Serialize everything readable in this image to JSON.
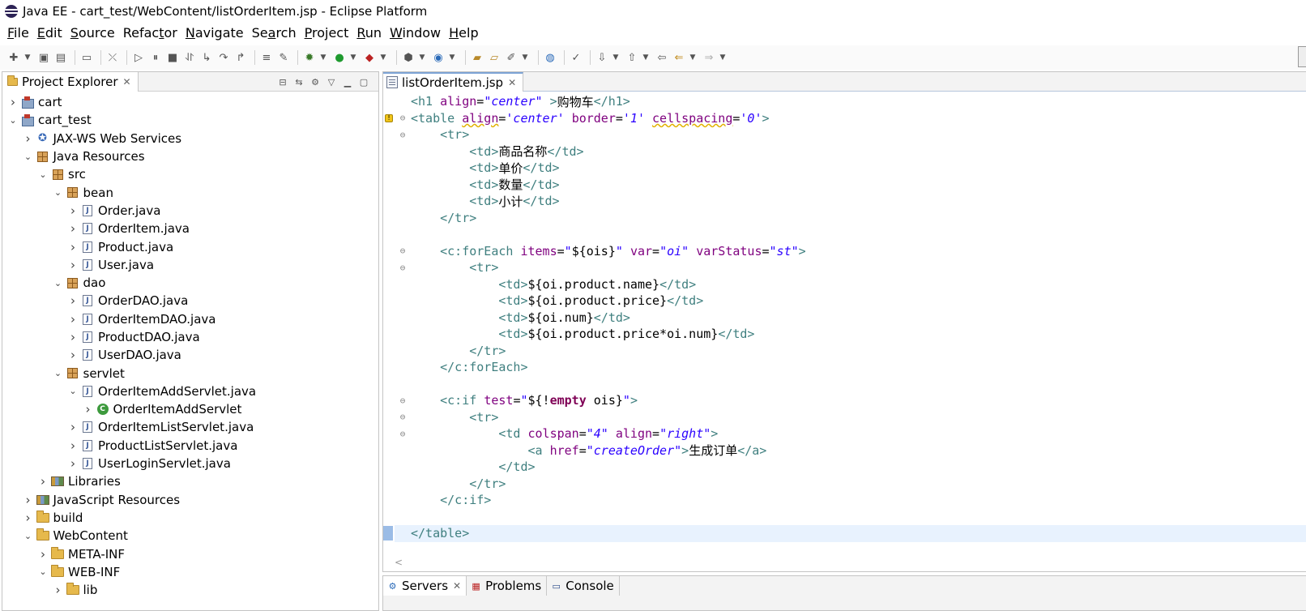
{
  "window": {
    "title": "Java EE - cart_test/WebContent/listOrderItem.jsp - Eclipse Platform"
  },
  "menu": [
    {
      "pre": "",
      "u": "F",
      "post": "ile"
    },
    {
      "pre": "",
      "u": "E",
      "post": "dit"
    },
    {
      "pre": "",
      "u": "S",
      "post": "ource"
    },
    {
      "pre": "Refac",
      "u": "t",
      "post": "or"
    },
    {
      "pre": "",
      "u": "N",
      "post": "avigate"
    },
    {
      "pre": "Se",
      "u": "a",
      "post": "rch"
    },
    {
      "pre": "",
      "u": "P",
      "post": "roject"
    },
    {
      "pre": "",
      "u": "R",
      "post": "un"
    },
    {
      "pre": "",
      "u": "W",
      "post": "indow"
    },
    {
      "pre": "",
      "u": "H",
      "post": "elp"
    }
  ],
  "project_explorer": {
    "title": "Project Explorer",
    "items": [
      {
        "label": "cart",
        "depth": 0,
        "twisty": "closed",
        "icon": "project"
      },
      {
        "label": "cart_test",
        "depth": 0,
        "twisty": "open",
        "icon": "project"
      },
      {
        "label": "JAX-WS Web Services",
        "depth": 1,
        "twisty": "closed",
        "icon": "webservice"
      },
      {
        "label": "Java Resources",
        "depth": 1,
        "twisty": "open",
        "icon": "package"
      },
      {
        "label": "src",
        "depth": 2,
        "twisty": "open",
        "icon": "package"
      },
      {
        "label": "bean",
        "depth": 3,
        "twisty": "open",
        "icon": "package"
      },
      {
        "label": "Order.java",
        "depth": 4,
        "twisty": "closed",
        "icon": "java"
      },
      {
        "label": "OrderItem.java",
        "depth": 4,
        "twisty": "closed",
        "icon": "java"
      },
      {
        "label": "Product.java",
        "depth": 4,
        "twisty": "closed",
        "icon": "java"
      },
      {
        "label": "User.java",
        "depth": 4,
        "twisty": "closed",
        "icon": "java"
      },
      {
        "label": "dao",
        "depth": 3,
        "twisty": "open",
        "icon": "package"
      },
      {
        "label": "OrderDAO.java",
        "depth": 4,
        "twisty": "closed",
        "icon": "java"
      },
      {
        "label": "OrderItemDAO.java",
        "depth": 4,
        "twisty": "closed",
        "icon": "java"
      },
      {
        "label": "ProductDAO.java",
        "depth": 4,
        "twisty": "closed",
        "icon": "java"
      },
      {
        "label": "UserDAO.java",
        "depth": 4,
        "twisty": "closed",
        "icon": "java"
      },
      {
        "label": "servlet",
        "depth": 3,
        "twisty": "open",
        "icon": "package"
      },
      {
        "label": "OrderItemAddServlet.java",
        "depth": 4,
        "twisty": "open",
        "icon": "java"
      },
      {
        "label": "OrderItemAddServlet",
        "depth": 5,
        "twisty": "closed",
        "icon": "class"
      },
      {
        "label": "OrderItemListServlet.java",
        "depth": 4,
        "twisty": "closed",
        "icon": "java"
      },
      {
        "label": "ProductListServlet.java",
        "depth": 4,
        "twisty": "closed",
        "icon": "java"
      },
      {
        "label": "UserLoginServlet.java",
        "depth": 4,
        "twisty": "closed",
        "icon": "java"
      },
      {
        "label": "Libraries",
        "depth": 2,
        "twisty": "closed",
        "icon": "library"
      },
      {
        "label": "JavaScript Resources",
        "depth": 1,
        "twisty": "closed",
        "icon": "library"
      },
      {
        "label": "build",
        "depth": 1,
        "twisty": "closed",
        "icon": "folder"
      },
      {
        "label": "WebContent",
        "depth": 1,
        "twisty": "open",
        "icon": "folder"
      },
      {
        "label": "META-INF",
        "depth": 2,
        "twisty": "closed",
        "icon": "folder"
      },
      {
        "label": "WEB-INF",
        "depth": 2,
        "twisty": "open",
        "icon": "folder"
      },
      {
        "label": "lib",
        "depth": 3,
        "twisty": "closed",
        "icon": "folder"
      }
    ]
  },
  "editor": {
    "tab_label": "listOrderItem.jsp",
    "lines": [
      {
        "fold": "",
        "tokens": [
          [
            "t",
            "<h1 "
          ],
          [
            "a",
            "align"
          ],
          [
            "x",
            "="
          ],
          [
            "v",
            "\"center\""
          ],
          [
            "x",
            " "
          ],
          [
            "t",
            ">"
          ],
          [
            "x",
            "购物车"
          ],
          [
            "t",
            "</h1>"
          ]
        ]
      },
      {
        "fold": "⊖",
        "warn": true,
        "tokens": [
          [
            "t",
            "<table "
          ],
          [
            "a sq",
            "align"
          ],
          [
            "x",
            "="
          ],
          [
            "v",
            "'center'"
          ],
          [
            "x",
            " "
          ],
          [
            "a",
            "border"
          ],
          [
            "x",
            "="
          ],
          [
            "v",
            "'1'"
          ],
          [
            "x",
            " "
          ],
          [
            "a sq",
            "cellspacing"
          ],
          [
            "x",
            "="
          ],
          [
            "v",
            "'0'"
          ],
          [
            "t",
            ">"
          ]
        ]
      },
      {
        "fold": "⊖",
        "tokens": [
          [
            "x",
            "    "
          ],
          [
            "t",
            "<tr>"
          ]
        ]
      },
      {
        "fold": "",
        "tokens": [
          [
            "x",
            "        "
          ],
          [
            "t",
            "<td>"
          ],
          [
            "x",
            "商品名称"
          ],
          [
            "t",
            "</td>"
          ]
        ]
      },
      {
        "fold": "",
        "tokens": [
          [
            "x",
            "        "
          ],
          [
            "t",
            "<td>"
          ],
          [
            "x",
            "单价"
          ],
          [
            "t",
            "</td>"
          ]
        ]
      },
      {
        "fold": "",
        "tokens": [
          [
            "x",
            "        "
          ],
          [
            "t",
            "<td>"
          ],
          [
            "x",
            "数量"
          ],
          [
            "t",
            "</td>"
          ]
        ]
      },
      {
        "fold": "",
        "tokens": [
          [
            "x",
            "        "
          ],
          [
            "t",
            "<td>"
          ],
          [
            "x",
            "小计"
          ],
          [
            "t",
            "</td>"
          ]
        ]
      },
      {
        "fold": "",
        "tokens": [
          [
            "x",
            "    "
          ],
          [
            "t",
            "</tr>"
          ]
        ]
      },
      {
        "fold": "",
        "tokens": []
      },
      {
        "fold": "⊖",
        "tokens": [
          [
            "x",
            "    "
          ],
          [
            "t",
            "<c:forEach "
          ],
          [
            "a",
            "items"
          ],
          [
            "x",
            "="
          ],
          [
            "v",
            "\""
          ],
          [
            "x",
            "${ois}"
          ],
          [
            "v",
            "\""
          ],
          [
            "x",
            " "
          ],
          [
            "a",
            "var"
          ],
          [
            "x",
            "="
          ],
          [
            "v",
            "\"oi\""
          ],
          [
            "x",
            " "
          ],
          [
            "a",
            "varStatus"
          ],
          [
            "x",
            "="
          ],
          [
            "v",
            "\"st\""
          ],
          [
            "t",
            ">"
          ]
        ]
      },
      {
        "fold": "⊖",
        "tokens": [
          [
            "x",
            "        "
          ],
          [
            "t",
            "<tr>"
          ]
        ]
      },
      {
        "fold": "",
        "tokens": [
          [
            "x",
            "            "
          ],
          [
            "t",
            "<td>"
          ],
          [
            "x",
            "${oi.product.name}"
          ],
          [
            "t",
            "</td>"
          ]
        ]
      },
      {
        "fold": "",
        "tokens": [
          [
            "x",
            "            "
          ],
          [
            "t",
            "<td>"
          ],
          [
            "x",
            "${oi.product.price}"
          ],
          [
            "t",
            "</td>"
          ]
        ]
      },
      {
        "fold": "",
        "tokens": [
          [
            "x",
            "            "
          ],
          [
            "t",
            "<td>"
          ],
          [
            "x",
            "${oi.num}"
          ],
          [
            "t",
            "</td>"
          ]
        ]
      },
      {
        "fold": "",
        "tokens": [
          [
            "x",
            "            "
          ],
          [
            "t",
            "<td>"
          ],
          [
            "x",
            "${oi.product.price*oi.num}"
          ],
          [
            "t",
            "</td>"
          ]
        ]
      },
      {
        "fold": "",
        "tokens": [
          [
            "x",
            "        "
          ],
          [
            "t",
            "</tr>"
          ]
        ]
      },
      {
        "fold": "",
        "tokens": [
          [
            "x",
            "    "
          ],
          [
            "t",
            "</c:forEach>"
          ]
        ]
      },
      {
        "fold": "",
        "tokens": []
      },
      {
        "fold": "⊖",
        "tokens": [
          [
            "x",
            "    "
          ],
          [
            "t",
            "<c:if "
          ],
          [
            "a",
            "test"
          ],
          [
            "x",
            "="
          ],
          [
            "v",
            "\""
          ],
          [
            "x",
            "${!"
          ],
          [
            "kw",
            "empty"
          ],
          [
            "x",
            " ois}"
          ],
          [
            "v",
            "\""
          ],
          [
            "t",
            ">"
          ]
        ]
      },
      {
        "fold": "⊖",
        "tokens": [
          [
            "x",
            "        "
          ],
          [
            "t",
            "<tr>"
          ]
        ]
      },
      {
        "fold": "⊖",
        "tokens": [
          [
            "x",
            "            "
          ],
          [
            "t",
            "<td "
          ],
          [
            "a",
            "colspan"
          ],
          [
            "x",
            "="
          ],
          [
            "v",
            "\"4\""
          ],
          [
            "x",
            " "
          ],
          [
            "a",
            "align"
          ],
          [
            "x",
            "="
          ],
          [
            "v",
            "\"right\""
          ],
          [
            "t",
            ">"
          ]
        ]
      },
      {
        "fold": "",
        "tokens": [
          [
            "x",
            "                "
          ],
          [
            "t",
            "<a "
          ],
          [
            "a",
            "href"
          ],
          [
            "x",
            "="
          ],
          [
            "v",
            "\"createOrder\""
          ],
          [
            "t",
            ">"
          ],
          [
            "x",
            "生成订单"
          ],
          [
            "t",
            "</a>"
          ]
        ]
      },
      {
        "fold": "",
        "tokens": [
          [
            "x",
            "            "
          ],
          [
            "t",
            "</td>"
          ]
        ]
      },
      {
        "fold": "",
        "tokens": [
          [
            "x",
            "        "
          ],
          [
            "t",
            "</tr>"
          ]
        ]
      },
      {
        "fold": "",
        "tokens": [
          [
            "x",
            "    "
          ],
          [
            "t",
            "</c:if>"
          ]
        ]
      },
      {
        "fold": "",
        "tokens": []
      },
      {
        "fold": "",
        "current": true,
        "tokens": [
          [
            "t",
            "</table>"
          ]
        ]
      }
    ],
    "hscroll_glyph": "<"
  },
  "bottom_tabs": [
    {
      "label": "Servers",
      "icon": "servers-icon",
      "active": true
    },
    {
      "label": "Problems",
      "icon": "problems-icon",
      "active": false
    },
    {
      "label": "Console",
      "icon": "console-icon",
      "active": false
    }
  ]
}
